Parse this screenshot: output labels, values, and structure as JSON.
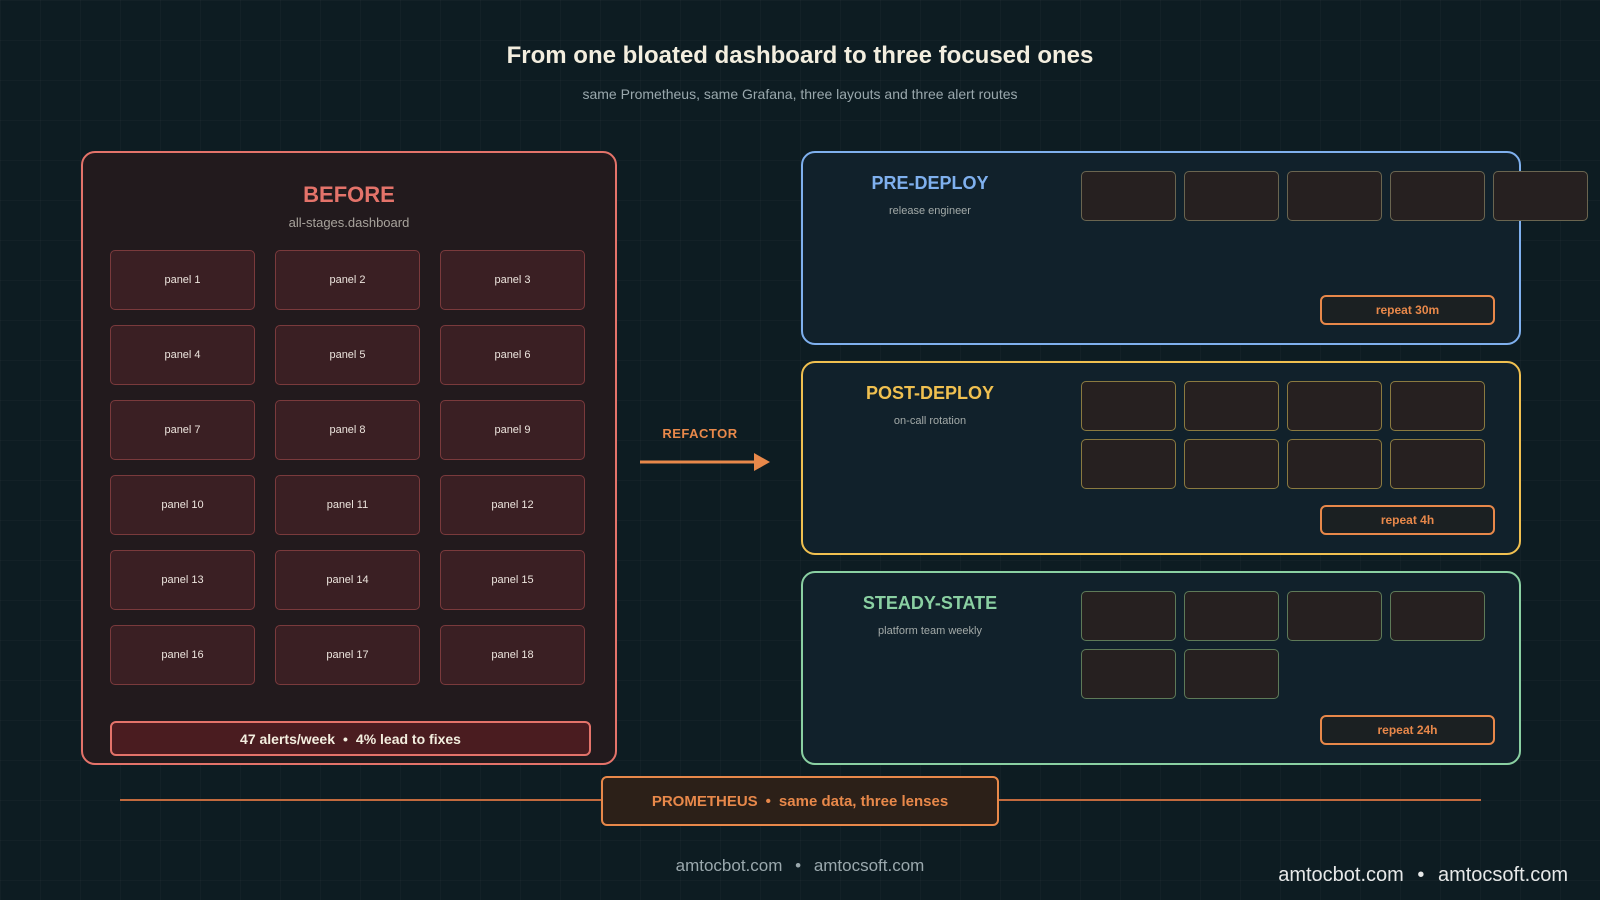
{
  "title": "From one bloated dashboard to three focused ones",
  "subtitle": "same Prometheus, same Grafana, three layouts and three alert routes",
  "before": {
    "title": "BEFORE",
    "subtitle": "all-stages.dashboard",
    "panels": [
      "panel 1",
      "panel 2",
      "panel 3",
      "panel 4",
      "panel 5",
      "panel 6",
      "panel 7",
      "panel 8",
      "panel 9",
      "panel 10",
      "panel 11",
      "panel 12",
      "panel 13",
      "panel 14",
      "panel 15",
      "panel 16",
      "panel 17",
      "panel 18"
    ],
    "footer_alerts": "47 alerts/week",
    "footer_sep": "•",
    "footer_fixes": "4% lead to fixes",
    "color": "#e4736a"
  },
  "arrow": {
    "label": "REFACTOR",
    "color": "#e8884a"
  },
  "stages": [
    {
      "title": "PRE-DEPLOY",
      "subtitle": "release engineer",
      "repeat": "repeat 30m",
      "panel_count": 5,
      "color": "#7fb0ee",
      "panel_border": "#6a6550"
    },
    {
      "title": "POST-DEPLOY",
      "subtitle": "on-call rotation",
      "repeat": "repeat 4h",
      "panel_count": 8,
      "color": "#f0c050",
      "panel_border": "#8a7a40"
    },
    {
      "title": "STEADY-STATE",
      "subtitle": "platform team weekly",
      "repeat": "repeat 24h",
      "panel_count": 6,
      "color": "#8ad0a2",
      "panel_border": "#5e7a58"
    }
  ],
  "prometheus": {
    "label": "PROMETHEUS",
    "sep": "•",
    "tagline": "same data, three lenses"
  },
  "footer": {
    "site1": "amtocbot.com",
    "sep": "•",
    "site2": "amtocsoft.com"
  },
  "watermark": {
    "site1": "amtocbot.com",
    "sep": "•",
    "site2": "amtocsoft.com"
  }
}
